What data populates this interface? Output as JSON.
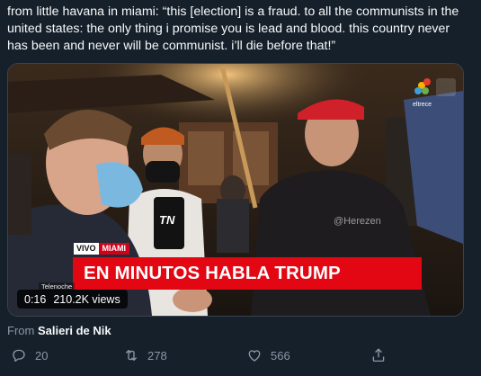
{
  "tweet": {
    "text": "from little havana in miami: “this [election] is a fraud. to all the communists in the united states: the only thing i promise you is lead and blood. this country never has been and never will be communist. i’ll die before that!”"
  },
  "video": {
    "live_badge": "VIVO",
    "location": "MIAMI",
    "headline": "EN MINUTOS HABLA TRUMP",
    "program_label": "Telenoche",
    "watermark": "@Herezen",
    "channel_label": "eltrece",
    "channel_logo_text": "TN",
    "duration": "0:16",
    "views": "210.2K views"
  },
  "source": {
    "prefix": "From",
    "account": "Salieri de Nik"
  },
  "actions": {
    "replies": "20",
    "retweets": "278",
    "likes": "566"
  },
  "colors": {
    "background": "#15202b",
    "muted": "#8b98a5",
    "headline_red": "#e30613"
  }
}
